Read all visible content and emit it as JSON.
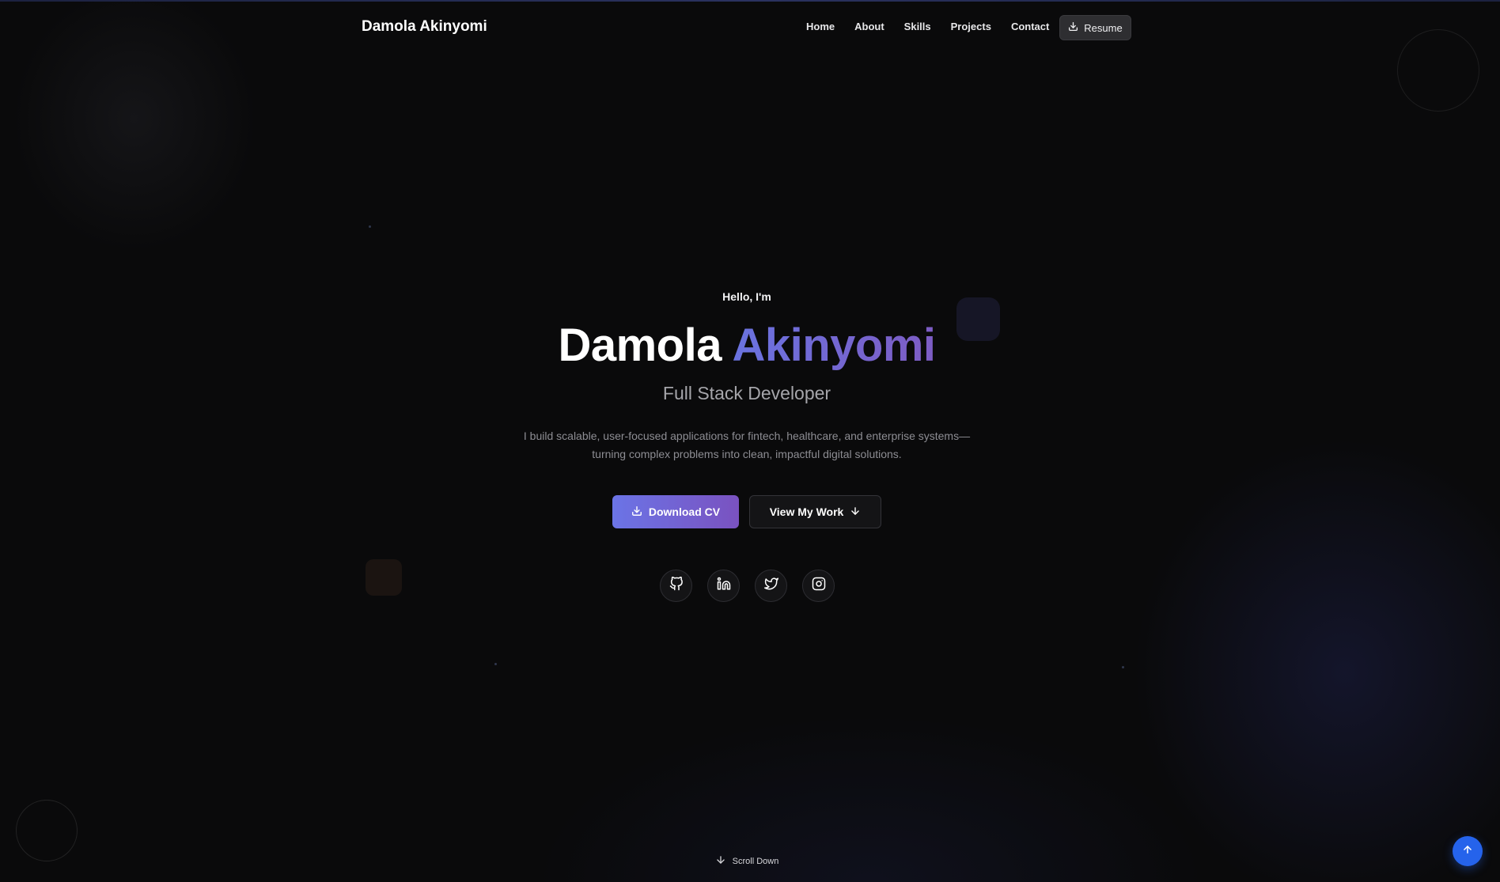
{
  "nav": {
    "brand": "Damola Akinyomi",
    "links": [
      "Home",
      "About",
      "Skills",
      "Projects",
      "Contact"
    ],
    "resume_label": "Resume"
  },
  "hero": {
    "greeting": "Hello, I'm",
    "name_first": "Damola",
    "name_last": "Akinyomi",
    "role": "Full Stack Developer",
    "bio_line1": "I build scalable, user-focused applications for fintech, healthcare, and enterprise systems—",
    "bio_line2": "turning complex problems into clean, impactful digital solutions.",
    "primary_cta": "Download CV",
    "secondary_cta": "View My Work",
    "socials": [
      "github-icon",
      "linkedin-icon",
      "twitter-icon",
      "instagram-icon"
    ],
    "scroll_label": "Scroll Down"
  },
  "colors": {
    "background": "#0a0a0b",
    "accent_start": "#6b74e6",
    "accent_end": "#7a52c0",
    "back_to_top": "#2563eb"
  }
}
